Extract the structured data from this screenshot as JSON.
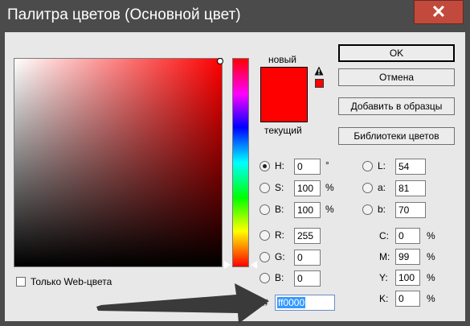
{
  "window": {
    "title": "Палитра цветов (Основной цвет)",
    "close_glyph": "✕"
  },
  "swatch": {
    "new_label": "новый",
    "current_label": "текущий",
    "new_color": "#ff0000",
    "current_color": "#ff0000",
    "warning_icon": "gamut-warning-icon"
  },
  "buttons": {
    "ok": "OK",
    "cancel": "Отмена",
    "add_to_swatches": "Добавить в образцы",
    "color_libraries": "Библиотеки цветов"
  },
  "hsb": {
    "h": {
      "label": "H:",
      "value": "0",
      "unit": "°",
      "checked": true
    },
    "s": {
      "label": "S:",
      "value": "100",
      "unit": "%"
    },
    "b": {
      "label": "B:",
      "value": "100",
      "unit": "%"
    }
  },
  "rgb": {
    "r": {
      "label": "R:",
      "value": "255"
    },
    "g": {
      "label": "G:",
      "value": "0"
    },
    "b": {
      "label": "B:",
      "value": "0"
    }
  },
  "lab": {
    "l": {
      "label": "L:",
      "value": "54"
    },
    "a": {
      "label": "a:",
      "value": "81"
    },
    "b": {
      "label": "b:",
      "value": "70"
    }
  },
  "cmyk": {
    "c": {
      "label": "C:",
      "value": "0",
      "unit": "%"
    },
    "m": {
      "label": "M:",
      "value": "99",
      "unit": "%"
    },
    "y": {
      "label": "Y:",
      "value": "100",
      "unit": "%"
    },
    "k": {
      "label": "K:",
      "value": "0",
      "unit": "%"
    }
  },
  "hex": {
    "label": "#",
    "value": "ff0000"
  },
  "web_only": {
    "label": "Только Web-цвета",
    "checked": false
  }
}
